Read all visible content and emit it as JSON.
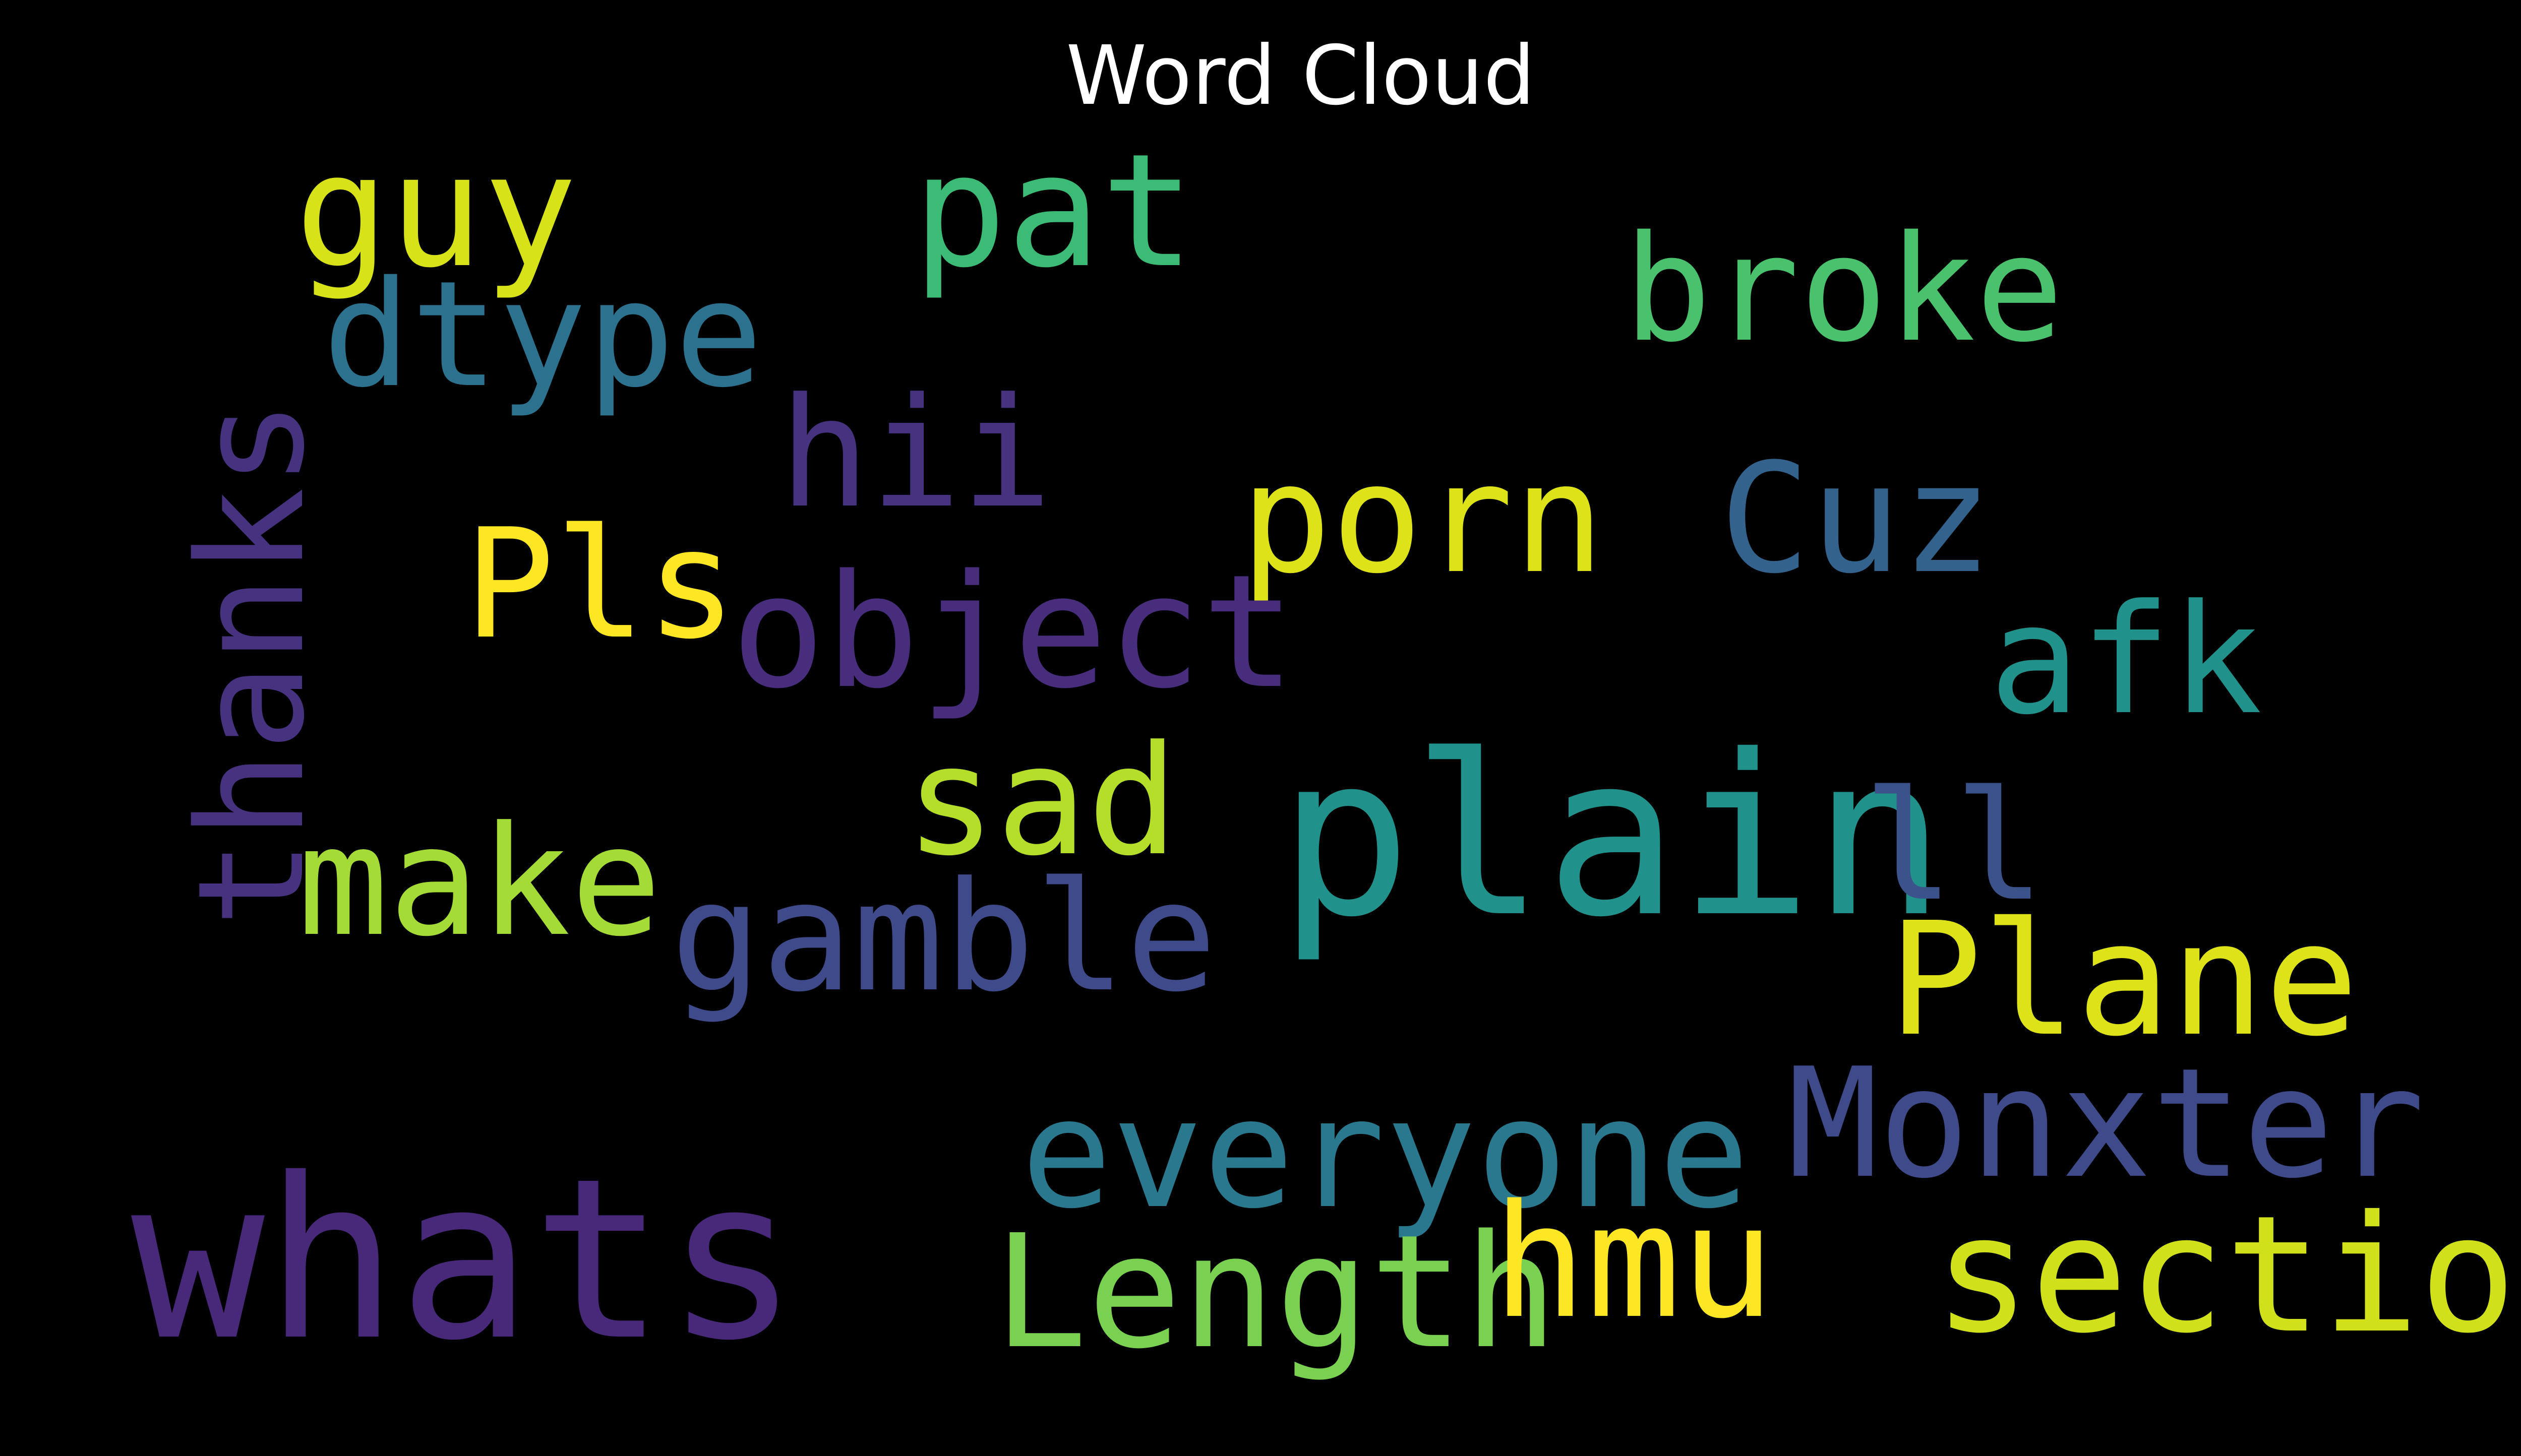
{
  "title": "Word Cloud",
  "background_color": "#000000",
  "title_color": "#ffffff",
  "colormap": "viridis",
  "words": [
    {
      "text": "guy",
      "color": "#d8e219",
      "orientation": "horizontal"
    },
    {
      "text": "pat",
      "color": "#3bbb75",
      "orientation": "horizontal"
    },
    {
      "text": "broke",
      "color": "#4ac16d",
      "orientation": "horizontal"
    },
    {
      "text": "dtype",
      "color": "#2c728e",
      "orientation": "horizontal"
    },
    {
      "text": "hii",
      "color": "#46327e",
      "orientation": "horizontal"
    },
    {
      "text": "thanks",
      "color": "#46327e",
      "orientation": "vertical"
    },
    {
      "text": "porn",
      "color": "#dde318",
      "orientation": "horizontal"
    },
    {
      "text": "Cuz",
      "color": "#33638d",
      "orientation": "horizontal"
    },
    {
      "text": "Pls",
      "color": "#fde725",
      "orientation": "horizontal"
    },
    {
      "text": "object",
      "color": "#472d7b",
      "orientation": "horizontal"
    },
    {
      "text": "afk",
      "color": "#21918c",
      "orientation": "horizontal"
    },
    {
      "text": "sad",
      "color": "#b5de2b",
      "orientation": "horizontal"
    },
    {
      "text": "plain",
      "color": "#21918c",
      "orientation": "horizontal"
    },
    {
      "text": "ll",
      "color": "#3b528b",
      "orientation": "horizontal"
    },
    {
      "text": "make",
      "color": "#a5db36",
      "orientation": "horizontal"
    },
    {
      "text": "gamble",
      "color": "#3e4a89",
      "orientation": "horizontal"
    },
    {
      "text": "Plane",
      "color": "#dde318",
      "orientation": "horizontal"
    },
    {
      "text": "Monxter",
      "color": "#3e4a89",
      "orientation": "horizontal"
    },
    {
      "text": "everyone",
      "color": "#2a788e",
      "orientation": "horizontal"
    },
    {
      "text": "whats",
      "color": "#482878",
      "orientation": "horizontal"
    },
    {
      "text": "Length",
      "color": "#7ad151",
      "orientation": "horizontal"
    },
    {
      "text": "hmu",
      "color": "#fde725",
      "orientation": "horizontal"
    },
    {
      "text": "section",
      "color": "#d0e11c",
      "orientation": "horizontal"
    }
  ]
}
